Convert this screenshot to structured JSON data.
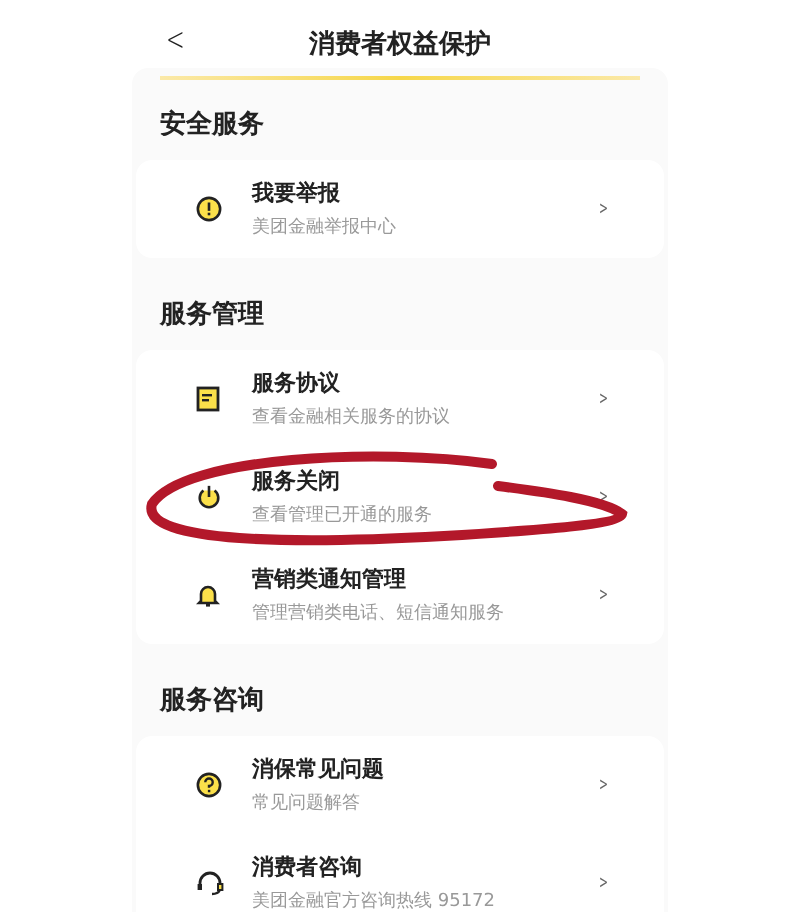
{
  "header": {
    "back": "<",
    "title": "消费者权益保护"
  },
  "sections": [
    {
      "title": "安全服务",
      "items": [
        {
          "kind": "alert",
          "title": "我要举报",
          "subtitle": "美团金融举报中心",
          "arrow": ">"
        }
      ]
    },
    {
      "title": "服务管理",
      "items": [
        {
          "kind": "document",
          "title": "服务协议",
          "subtitle": "查看金融相关服务的协议",
          "arrow": ">"
        },
        {
          "kind": "power",
          "title": "服务关闭",
          "subtitle": "查看管理已开通的服务",
          "arrow": ">"
        },
        {
          "kind": "bell",
          "title": "营销类通知管理",
          "subtitle": "管理营销类电话、短信通知服务",
          "arrow": ">"
        }
      ]
    },
    {
      "title": "服务咨询",
      "items": [
        {
          "kind": "question",
          "title": "消保常见问题",
          "subtitle": "常见问题解答",
          "arrow": ">"
        },
        {
          "kind": "headset",
          "title": "消费者咨询",
          "subtitle": "美团金融官方咨询热线 95172",
          "arrow": ">"
        }
      ]
    }
  ]
}
